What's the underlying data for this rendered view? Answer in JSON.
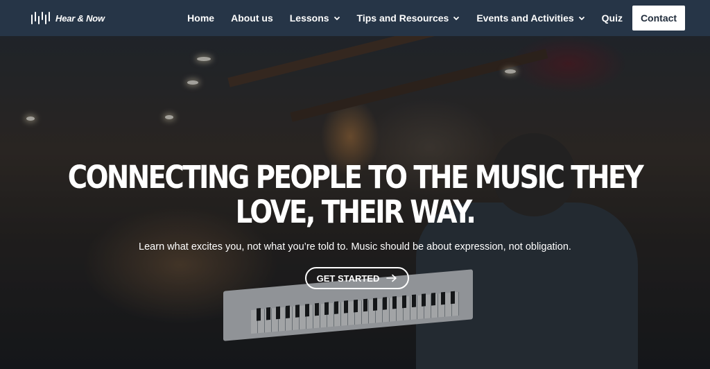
{
  "brand": {
    "name": "Hear & Now",
    "logo_icon": "soundwave-icon"
  },
  "nav": {
    "items": [
      {
        "label": "Home",
        "dropdown": false
      },
      {
        "label": "About us",
        "dropdown": false
      },
      {
        "label": "Lessons",
        "dropdown": true
      },
      {
        "label": "Tips and Resources",
        "dropdown": true
      },
      {
        "label": "Events and Activities",
        "dropdown": true
      },
      {
        "label": "Quiz",
        "dropdown": false
      }
    ],
    "cta_label": "Contact"
  },
  "hero": {
    "title": "Connecting people to the music they love, their way.",
    "subtitle": "Learn what excites you, not what you’re told to. Music should be about expression, not obligation.",
    "cta_label": "GET STARTED",
    "cta_icon": "arrow-right-icon"
  },
  "colors": {
    "nav_bg": "#263547",
    "text": "#ffffff",
    "contact_bg": "#ffffff"
  }
}
